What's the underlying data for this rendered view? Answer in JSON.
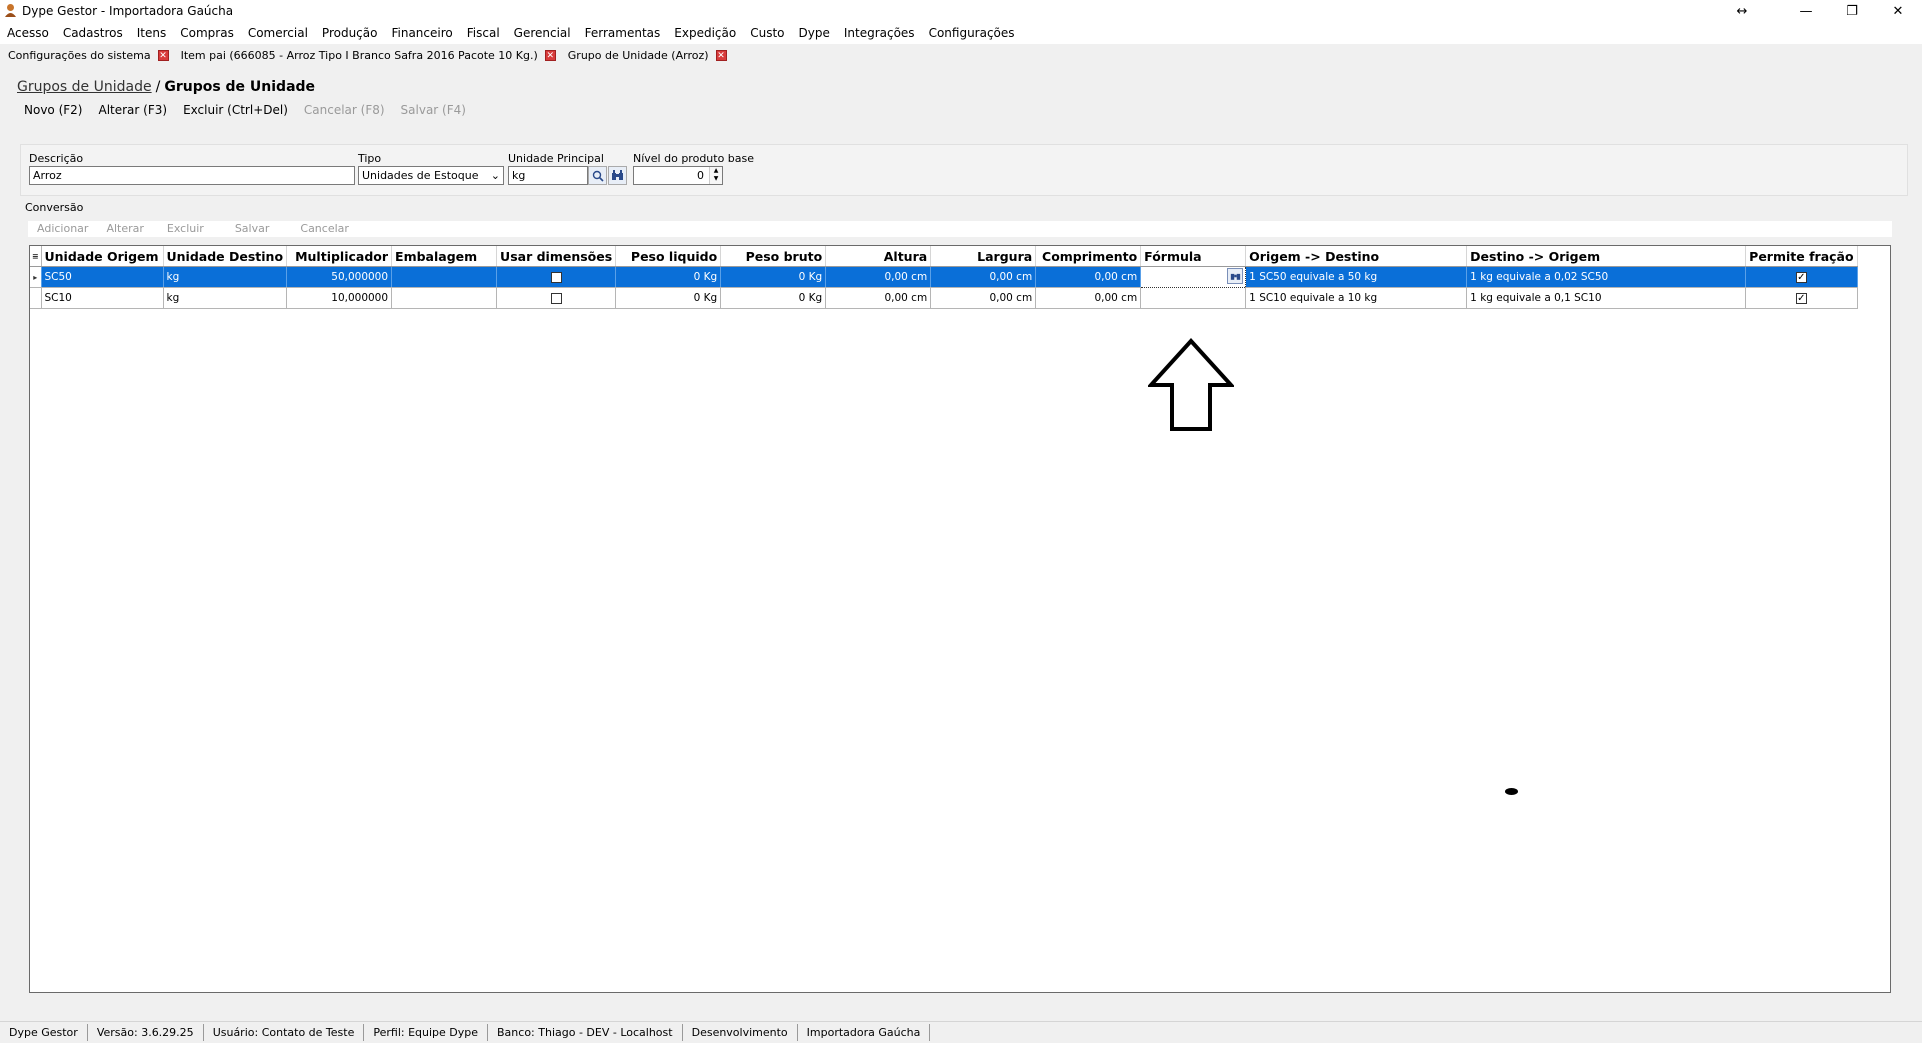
{
  "window": {
    "title": "Dype Gestor - Importadora Gaúcha",
    "buttons": [
      "↔",
      "—",
      "❐",
      "✕"
    ]
  },
  "menu": [
    "Acesso",
    "Cadastros",
    "Itens",
    "Compras",
    "Comercial",
    "Produção",
    "Financeiro",
    "Fiscal",
    "Gerencial",
    "Ferramentas",
    "Expedição",
    "Custo",
    "Dype",
    "Integrações",
    "Configurações"
  ],
  "tabs": [
    {
      "label": "Configurações do sistema"
    },
    {
      "label": "Item pai (666085 - Arroz Tipo I Branco Safra 2016 Pacote 10 Kg.)"
    },
    {
      "label": "Grupo de Unidade (Arroz)"
    }
  ],
  "breadcrumb": {
    "link": "Grupos de Unidade",
    "separator": "/",
    "current": "Grupos de Unidade"
  },
  "toolbar": {
    "novo": "Novo (F2)",
    "alterar": "Alterar (F3)",
    "excluir": "Excluir (Ctrl+Del)",
    "cancelar": "Cancelar (F8)",
    "salvar": "Salvar (F4)"
  },
  "form": {
    "descricao_label": "Descrição",
    "descricao_value": "Arroz",
    "tipo_label": "Tipo",
    "tipo_value": "Unidades de Estoque",
    "unidade_label": "Unidade Principal",
    "unidade_value": "kg",
    "nivel_label": "Nível do produto base",
    "nivel_value": "0"
  },
  "conversao": {
    "label": "Conversão",
    "toolbar": {
      "adicionar": "Adicionar",
      "alterar": "Alterar",
      "excluir": "Excluir",
      "salvar": "Salvar",
      "cancelar": "Cancelar"
    }
  },
  "grid": {
    "columns": [
      "Unidade Origem",
      "Unidade Destino",
      "Multiplicador",
      "Embalagem",
      "Usar dimensões",
      "Peso liquido",
      "Peso bruto",
      "Altura",
      "Largura",
      "Comprimento",
      "Fórmula",
      "Origem -> Destino",
      "Destino -> Origem",
      "Permite fração"
    ],
    "rows": [
      {
        "origem": "SC50",
        "destino": "kg",
        "mult": "50,000000",
        "emb": "",
        "usar": false,
        "peso_liq": "0 Kg",
        "peso_bruto": "0 Kg",
        "altura": "0,00 cm",
        "largura": "0,00 cm",
        "comp": "0,00 cm",
        "formula": "",
        "o2d": "1 SC50 equivale a 50 kg",
        "d2o": "1 kg equivale a 0,02 SC50",
        "fracao": true
      },
      {
        "origem": "SC10",
        "destino": "kg",
        "mult": "10,000000",
        "emb": "",
        "usar": false,
        "peso_liq": "0 Kg",
        "peso_bruto": "0 Kg",
        "altura": "0,00 cm",
        "largura": "0,00 cm",
        "comp": "0,00 cm",
        "formula": "",
        "o2d": "1 SC10 equivale a 10 kg",
        "d2o": "1 kg equivale a 0,1 SC10",
        "fracao": true
      }
    ]
  },
  "status": [
    "Dype Gestor",
    "Versão: 3.6.29.25",
    "Usuário: Contato de Teste",
    "Perfil: Equipe Dype",
    "Banco: Thiago - DEV - Localhost",
    "Desenvolvimento",
    "Importadora Gaúcha"
  ]
}
